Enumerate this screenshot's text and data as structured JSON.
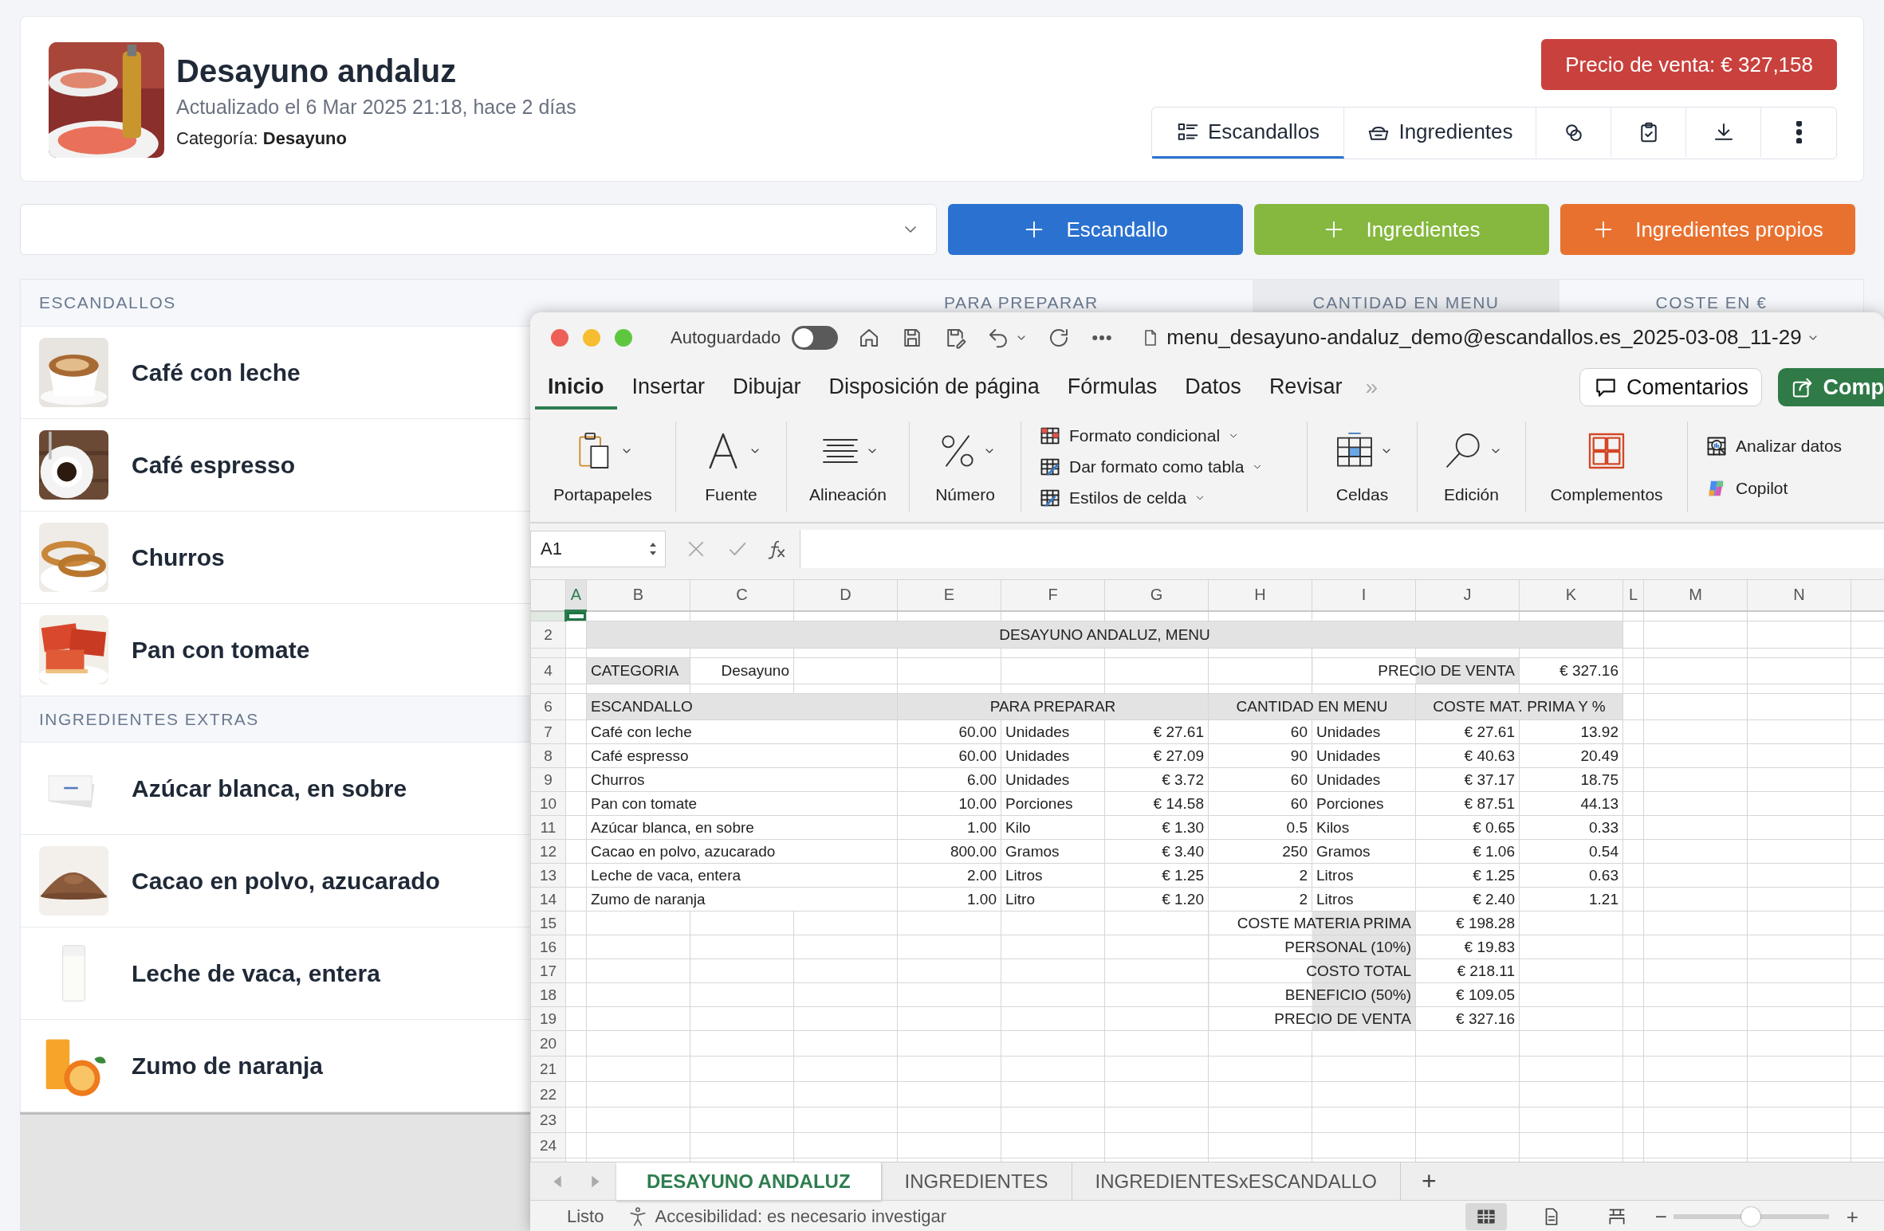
{
  "header": {
    "title": "Desayuno andaluz",
    "updated": "Actualizado el 6 Mar 2025 21:18, hace 2 días",
    "category_label": "Categoría:",
    "category": "Desayuno",
    "price_button": "Precio de venta: € 327,158",
    "tabs": [
      {
        "label": "Escandallos",
        "selected": true
      },
      {
        "label": "Ingredientes",
        "selected": false
      },
      {
        "selected": false
      },
      {
        "selected": false
      },
      {
        "selected": false
      },
      {
        "selected": false
      }
    ]
  },
  "actions": [
    {
      "label": "Escandallo",
      "kind": "primary"
    },
    {
      "label": "Ingredientes",
      "kind": "success"
    },
    {
      "label": "Ingredientes propios",
      "kind": "warning"
    }
  ],
  "list": {
    "columns": [
      "ESCANDALLOS",
      "PARA PREPARAR",
      "CANTIDAD EN MENU",
      "COSTE EN €"
    ],
    "items": [
      {
        "name": "Café con leche"
      },
      {
        "name": "Café espresso"
      },
      {
        "name": "Churros"
      },
      {
        "name": "Pan con tomate"
      }
    ],
    "extras_title": "INGREDIENTES EXTRAS",
    "extras": [
      {
        "name": "Azúcar blanca, en sobre"
      },
      {
        "name": "Cacao en polvo, azucarado"
      },
      {
        "name": "Leche de vaca, entera"
      },
      {
        "name": "Zumo de naranja"
      }
    ]
  },
  "excel": {
    "autosave_label": "Autoguardado",
    "autosave_on": false,
    "filename": "menu_desayuno-andaluz_demo@escandallos.es_2025-03-08_11-29",
    "menu_tabs": [
      {
        "label": "Inicio",
        "selected": true
      },
      {
        "label": "Insertar",
        "selected": false
      },
      {
        "label": "Dibujar",
        "selected": false
      },
      {
        "label": "Disposición de página",
        "selected": false
      },
      {
        "label": "Fórmulas",
        "selected": false
      },
      {
        "label": "Datos",
        "selected": false
      },
      {
        "label": "Revisar",
        "selected": false
      }
    ],
    "more_tabs": "»",
    "comments_button": "Comentarios",
    "share_button": "Comp",
    "ribbon": [
      {
        "kind": "large",
        "label": "Portapapeles"
      },
      {
        "kind": "large",
        "label": "Fuente"
      },
      {
        "kind": "large",
        "label": "Alineación"
      },
      {
        "kind": "large",
        "label": "Número"
      },
      {
        "kind": "list",
        "items": [
          "Formato condicional",
          "Dar formato como tabla",
          "Estilos de celda"
        ]
      },
      {
        "kind": "large",
        "label": "Celdas"
      },
      {
        "kind": "large",
        "label": "Edición"
      },
      {
        "kind": "large",
        "label": "Complementos"
      },
      {
        "kind": "list",
        "items": [
          "Analizar datos",
          "Copilot"
        ]
      }
    ],
    "name_box": "A1",
    "columns": [
      {
        "label": "A",
        "selected": true
      },
      {
        "label": "B",
        "selected": false
      },
      {
        "label": "C",
        "selected": false
      },
      {
        "label": "D",
        "selected": false
      },
      {
        "label": "E",
        "selected": false
      },
      {
        "label": "F",
        "selected": false
      },
      {
        "label": "G",
        "selected": false
      },
      {
        "label": "H",
        "selected": false
      },
      {
        "label": "I",
        "selected": false
      },
      {
        "label": "J",
        "selected": false
      },
      {
        "label": "K",
        "selected": false
      },
      {
        "label": "L",
        "selected": false
      },
      {
        "label": "M",
        "selected": false
      },
      {
        "label": "N",
        "selected": false
      }
    ],
    "rows": [
      {
        "kind": "spacer",
        "selected": true
      },
      {
        "number": "2",
        "kind": "title",
        "selected": false,
        "text": "DESAYUNO ANDALUZ, MENU"
      },
      {
        "kind": "spacer",
        "selected": false
      },
      {
        "number": "4",
        "kind": "info",
        "selected": false,
        "cells": [
          "CATEGORIA",
          "Desayuno",
          "PRECIO DE VENTA",
          "€ 327.16"
        ]
      },
      {
        "kind": "spacer",
        "selected": false
      },
      {
        "number": "6",
        "kind": "header",
        "selected": false,
        "cells": [
          "ESCANDALLO",
          "PARA PREPARAR",
          "CANTIDAD EN MENU",
          "COSTE MAT. PRIMA Y %"
        ]
      },
      {
        "number": "7",
        "kind": "item",
        "selected": false,
        "cells": [
          "Café con leche",
          "60.00",
          "Unidades",
          "€ 27.61",
          "60",
          "Unidades",
          "€ 27.61",
          "13.92"
        ]
      },
      {
        "number": "8",
        "kind": "item",
        "selected": false,
        "cells": [
          "Café espresso",
          "60.00",
          "Unidades",
          "€ 27.09",
          "90",
          "Unidades",
          "€ 40.63",
          "20.49"
        ]
      },
      {
        "number": "9",
        "kind": "item",
        "selected": false,
        "cells": [
          "Churros",
          "6.00",
          "Unidades",
          "€ 3.72",
          "60",
          "Unidades",
          "€ 37.17",
          "18.75"
        ]
      },
      {
        "number": "10",
        "kind": "item",
        "selected": false,
        "cells": [
          "Pan con tomate",
          "10.00",
          "Porciones",
          "€ 14.58",
          "60",
          "Porciones",
          "€ 87.51",
          "44.13"
        ]
      },
      {
        "number": "11",
        "kind": "item",
        "selected": false,
        "cells": [
          "Azúcar blanca, en sobre",
          "1.00",
          "Kilo",
          "€ 1.30",
          "0.5",
          "Kilos",
          "€ 0.65",
          "0.33"
        ]
      },
      {
        "number": "12",
        "kind": "item",
        "selected": false,
        "cells": [
          "Cacao en polvo, azucarado",
          "800.00",
          "Gramos",
          "€ 3.40",
          "250",
          "Gramos",
          "€ 1.06",
          "0.54"
        ]
      },
      {
        "number": "13",
        "kind": "item",
        "selected": false,
        "cells": [
          "Leche de vaca, entera",
          "2.00",
          "Litros",
          "€ 1.25",
          "2",
          "Litros",
          "€ 1.25",
          "0.63"
        ]
      },
      {
        "number": "14",
        "kind": "item",
        "selected": false,
        "cells": [
          "Zumo de naranja",
          "1.00",
          "Litro",
          "€ 1.20",
          "2",
          "Litros",
          "€ 2.40",
          "1.21"
        ]
      },
      {
        "number": "15",
        "kind": "total",
        "selected": false,
        "cells": [
          "COSTE MATERIA PRIMA",
          "€ 198.28"
        ]
      },
      {
        "number": "16",
        "kind": "total",
        "selected": false,
        "cells": [
          "PERSONAL (10%)",
          "€ 19.83"
        ]
      },
      {
        "number": "17",
        "kind": "total",
        "selected": false,
        "cells": [
          "COSTO TOTAL",
          "€ 218.11"
        ]
      },
      {
        "number": "18",
        "kind": "total",
        "selected": false,
        "cells": [
          "BENEFICIO (50%)",
          "€ 109.05"
        ]
      },
      {
        "number": "19",
        "kind": "total",
        "selected": false,
        "cells": [
          "PRECIO DE VENTA",
          "€ 327.16"
        ]
      },
      {
        "number": "20",
        "kind": "blank",
        "selected": false
      },
      {
        "number": "21",
        "kind": "blank",
        "selected": false
      },
      {
        "number": "22",
        "kind": "blank",
        "selected": false
      },
      {
        "number": "23",
        "kind": "blank",
        "selected": false
      },
      {
        "number": "24",
        "kind": "blank",
        "selected": false
      }
    ],
    "sheet_tabs": [
      {
        "label": "DESAYUNO ANDALUZ",
        "selected": true
      },
      {
        "label": "INGREDIENTES",
        "selected": false
      },
      {
        "label": "INGREDIENTESxESCANDALLO",
        "selected": false
      }
    ],
    "add_sheet": "+",
    "status": {
      "ready": "Listo",
      "accessibility": "Accesibilidad: es necesario investigar"
    },
    "zoom": {
      "minus": "−",
      "plus": "+",
      "level": 0.5
    }
  }
}
